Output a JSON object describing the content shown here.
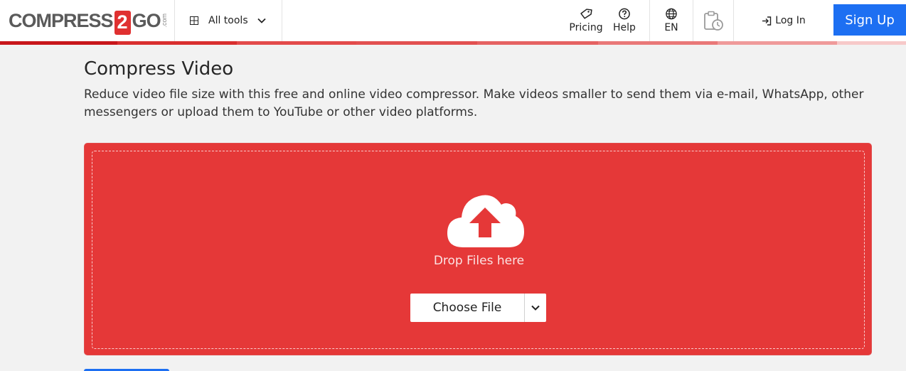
{
  "header": {
    "logo": {
      "part1": "COMPRESS",
      "part2": "2",
      "part3": "GO",
      "suffix": ".com"
    },
    "all_tools_label": "All tools",
    "pricing_label": "Pricing",
    "help_label": "Help",
    "language_label": "EN",
    "login_label": "Log In",
    "signup_label": "Sign Up"
  },
  "main": {
    "title": "Compress Video",
    "description": "Reduce video file size with this free and online video compressor. Make videos smaller to send them via e-mail, WhatsApp, other messengers or upload them to YouTube or other video platforms.",
    "drop_text": "Drop Files here",
    "choose_file_label": "Choose File"
  },
  "colors": {
    "accent_red": "#e53838",
    "signup_blue": "#1d6ff2",
    "logo_gray": "#5a5a5a"
  },
  "icons": [
    "grid-icon",
    "chevron-down-icon",
    "tag-icon",
    "help-circle-icon",
    "globe-icon",
    "clipboard-clock-icon",
    "login-icon",
    "cloud-upload-icon"
  ]
}
